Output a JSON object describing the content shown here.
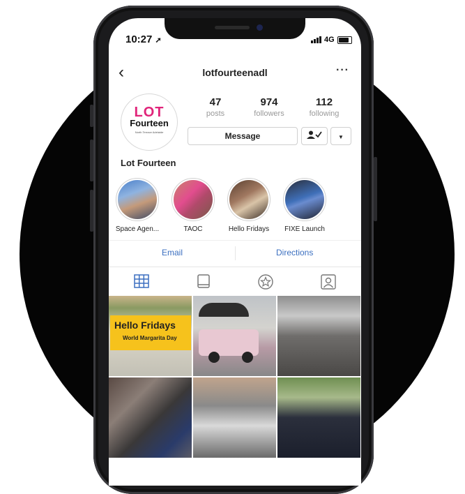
{
  "status_bar": {
    "time": "10:27",
    "network": "4G"
  },
  "profile": {
    "username": "lotfourteenadl",
    "name": "Lot Fourteen",
    "logo": {
      "line1": "LOT",
      "line2": "Fourteen",
      "tagline": "North Terrace Adelaide"
    },
    "stats": [
      {
        "value": "47",
        "label": "posts"
      },
      {
        "value": "974",
        "label": "followers"
      },
      {
        "value": "112",
        "label": "following"
      }
    ],
    "message_label": "Message"
  },
  "highlights": [
    {
      "caption": "Space Agen...",
      "name": "space-agency"
    },
    {
      "caption": "TAOC",
      "name": "taoc"
    },
    {
      "caption": "Hello Fridays",
      "name": "hello-fridays"
    },
    {
      "caption": "FIXE Launch",
      "name": "fixe-launch"
    }
  ],
  "contact": {
    "email_label": "Email",
    "directions_label": "Directions"
  },
  "posts": [
    {
      "title": "Hello Fridays",
      "subtitle": "World Margarita Day"
    }
  ],
  "colors": {
    "accent": "#3b6fc0",
    "logo_pink": "#e0247a",
    "text": "#222222"
  }
}
